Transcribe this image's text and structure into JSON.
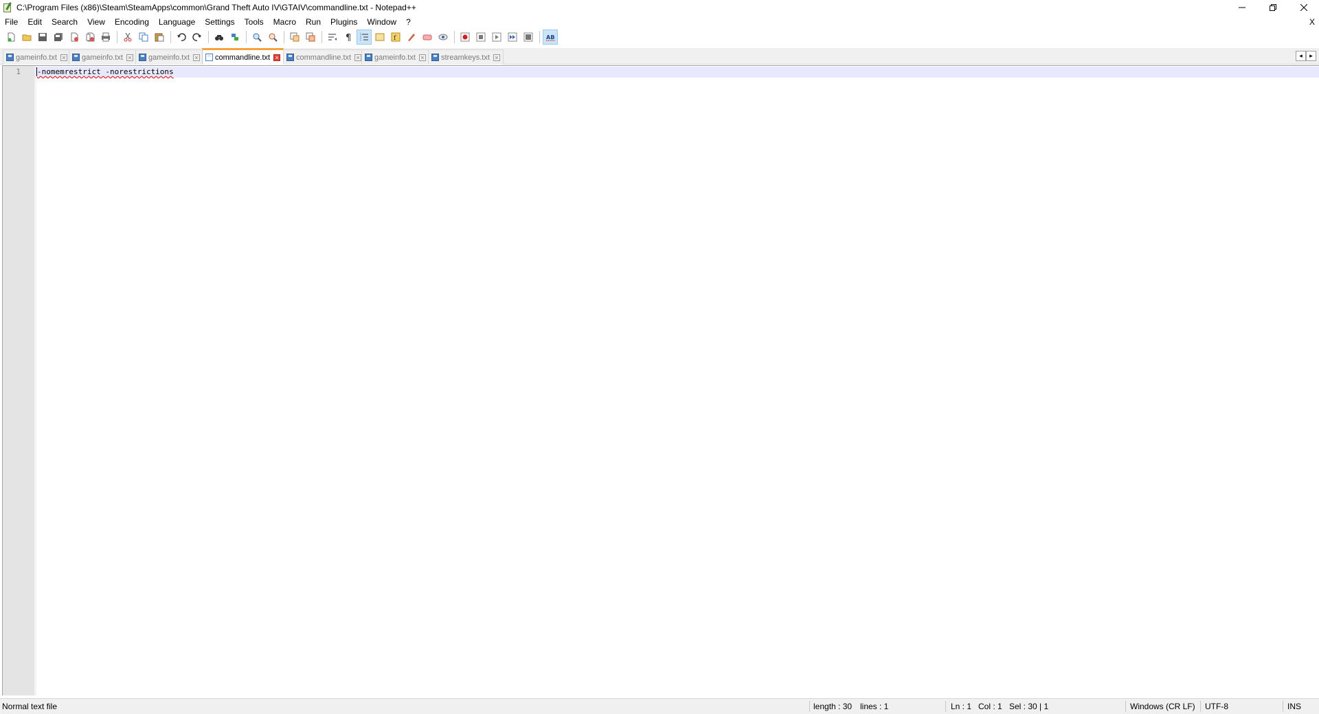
{
  "window": {
    "title": "C:\\Program Files (x86)\\Steam\\SteamApps\\common\\Grand Theft Auto IV\\GTAIV\\commandline.txt - Notepad++",
    "controls": [
      "minimize-icon",
      "restore-icon",
      "close-icon"
    ]
  },
  "menu": {
    "items": [
      "File",
      "Edit",
      "Search",
      "View",
      "Encoding",
      "Language",
      "Settings",
      "Tools",
      "Macro",
      "Run",
      "Plugins",
      "Window",
      "?"
    ],
    "close_doc": "X"
  },
  "toolbar": {
    "buttons": [
      "new-file-icon",
      "open-file-icon",
      "save-icon",
      "save-all-icon",
      "close-icon",
      "close-all-icon",
      "print-icon",
      "cut-icon",
      "copy-icon",
      "paste-icon",
      "undo-icon",
      "redo-icon",
      "find-icon",
      "replace-icon",
      "zoom-in-icon",
      "zoom-out-icon",
      "sync-vertical-icon",
      "sync-horizontal-icon",
      "word-wrap-icon",
      "show-all-chars-icon",
      "indent-guide-icon",
      "doc-map-icon",
      "function-list-icon",
      "folder-workspace-icon",
      "monitor-icon",
      "start-record-icon",
      "stop-record-icon",
      "playback-icon",
      "run-multiple-icon",
      "save-macro-icon",
      "spell-check-icon"
    ],
    "active": "indent-guide-icon",
    "spellcheck_label": "ABC"
  },
  "tabs": [
    {
      "label": "gameinfo.txt",
      "active": false
    },
    {
      "label": "gameinfo.txt",
      "active": false
    },
    {
      "label": "gameinfo.txt",
      "active": false
    },
    {
      "label": "commandline.txt",
      "active": true
    },
    {
      "label": "commandline.txt",
      "active": false
    },
    {
      "label": "gameinfo.txt",
      "active": false
    },
    {
      "label": "streamkeys.txt",
      "active": false
    }
  ],
  "tab_close_glyph": "×",
  "tab_scroll": {
    "left": "◂",
    "right": "▸"
  },
  "editor": {
    "line_number": "1",
    "content": "-nomemrestrict -norestrictions"
  },
  "status": {
    "file_type": "Normal text file",
    "length": "length : 30",
    "lines": "lines : 1",
    "ln": "Ln : 1",
    "col": "Col : 1",
    "sel": "Sel : 30 | 1",
    "eol": "Windows (CR LF)",
    "encoding": "UTF-8",
    "mode": "INS"
  },
  "colors": {
    "active_tab_accent": "#f7a13a",
    "current_line": "#e8e8ff",
    "gutter": "#e4e4e4",
    "tab_close_active": "#e0433c"
  }
}
